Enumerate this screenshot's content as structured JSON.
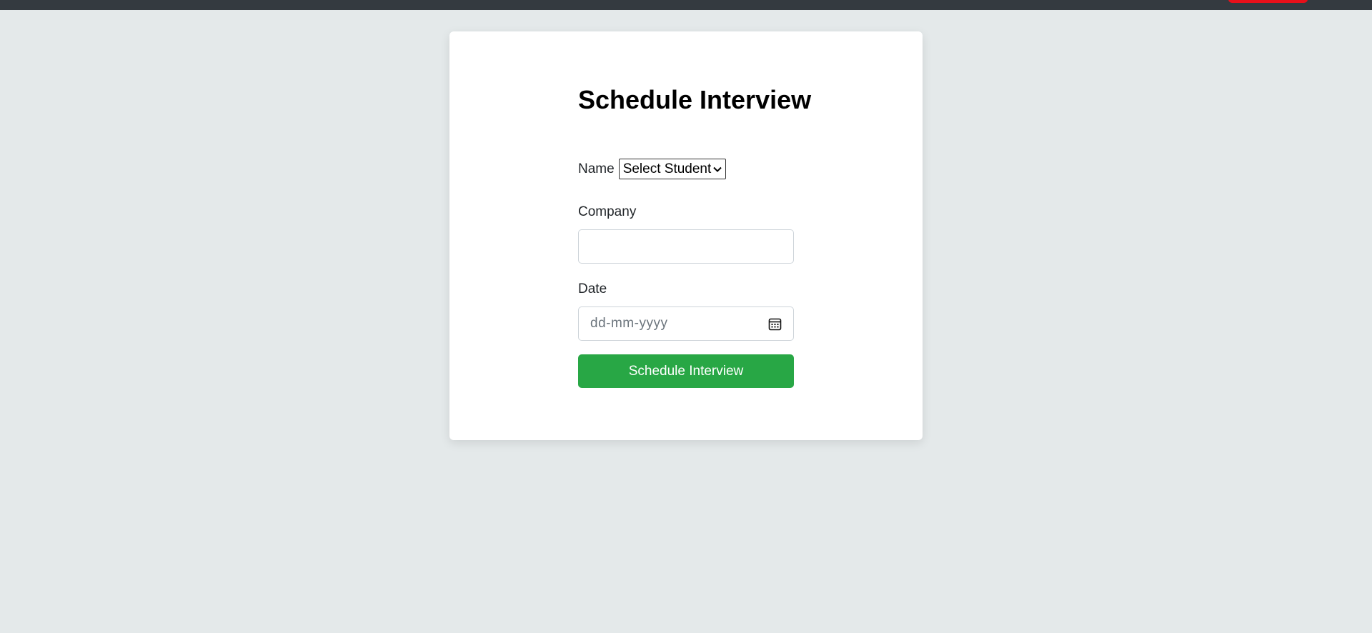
{
  "form": {
    "title": "Schedule Interview",
    "name_label": "Name",
    "name_select_value": "Select Student",
    "company_label": "Company",
    "company_value": "",
    "date_label": "Date",
    "date_placeholder": "dd-mm-yyyy",
    "submit_label": "Schedule Interview"
  },
  "colors": {
    "page_background": "#e4e9ea",
    "topbar": "#343a40",
    "topbar_button": "#e8101a",
    "submit_button": "#28a745"
  },
  "icons": {
    "select_chevron": "chevron-down-icon",
    "date_picker": "calendar-icon"
  }
}
